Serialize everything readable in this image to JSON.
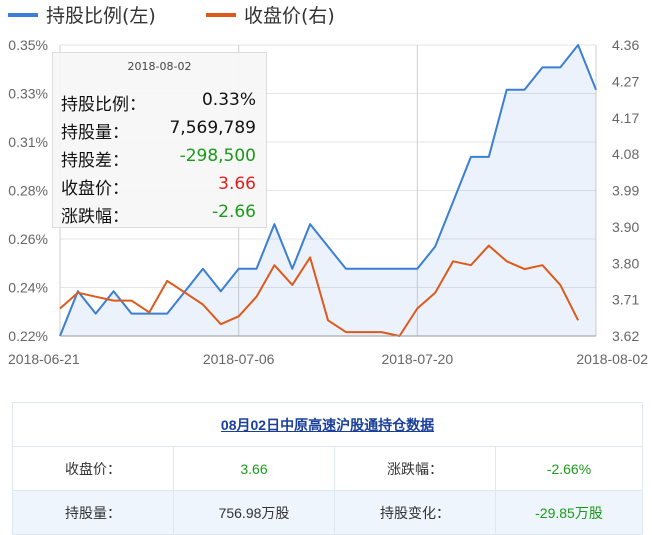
{
  "chart_data": {
    "type": "line",
    "legend": [
      {
        "name": "持股比例(左)",
        "color": "#3a7fd5"
      },
      {
        "name": "收盘价(右)",
        "color": "#dd5a1c"
      }
    ],
    "legend_position": "top-left",
    "x_tick_labels": [
      "2018-06-21",
      "2018-07-06",
      "2018-07-20",
      "2018-08-02"
    ],
    "y_left_ticks": [
      "0.35%",
      "0.33%",
      "0.31%",
      "0.28%",
      "0.26%",
      "0.24%",
      "0.22%"
    ],
    "y_right_ticks": [
      "4.36",
      "4.27",
      "4.17",
      "4.08",
      "3.99",
      "3.90",
      "3.80",
      "3.71",
      "3.62"
    ],
    "ylim_left": [
      0.22,
      0.35
    ],
    "ylim_right": [
      3.62,
      4.36
    ],
    "series": [
      {
        "name": "持股比例(左)",
        "axis": "left",
        "color": "#3a7fd5",
        "values": [
          0.22,
          0.24,
          0.23,
          0.24,
          0.23,
          0.23,
          0.23,
          0.24,
          0.25,
          0.24,
          0.25,
          0.25,
          0.27,
          0.25,
          0.27,
          0.26,
          0.25,
          0.25,
          0.25,
          0.25,
          0.25,
          0.26,
          0.28,
          0.3,
          0.3,
          0.33,
          0.33,
          0.34,
          0.34,
          0.35,
          0.33
        ]
      },
      {
        "name": "收盘价(右)",
        "axis": "right",
        "color": "#dd5a1c",
        "values": [
          3.69,
          3.73,
          3.72,
          3.71,
          3.71,
          3.68,
          3.76,
          3.73,
          3.7,
          3.65,
          3.67,
          3.72,
          3.8,
          3.75,
          3.82,
          3.66,
          3.63,
          3.63,
          3.63,
          3.62,
          3.69,
          3.73,
          3.81,
          3.8,
          3.85,
          3.81,
          3.79,
          3.8,
          3.75,
          3.66
        ]
      }
    ],
    "grid": true,
    "highlight_x_index": 30
  },
  "tooltip": {
    "date": "2018-08-02",
    "rows": [
      {
        "label": "持股比例：",
        "value": "0.33%",
        "tone": "normal"
      },
      {
        "label": "持股量：",
        "value": "7,569,789",
        "tone": "normal"
      },
      {
        "label": "持股差：",
        "value": "-298,500",
        "tone": "green"
      },
      {
        "label": "收盘价：",
        "value": "3.66",
        "tone": "red"
      },
      {
        "label": "涨跌幅：",
        "value": "-2.66",
        "tone": "green"
      }
    ]
  },
  "table": {
    "title": "08月02日中原高速沪股通持仓数据",
    "rows": [
      [
        {
          "text": "收盘价：",
          "tone": "normal"
        },
        {
          "text": "3.66",
          "tone": "green"
        },
        {
          "text": "涨跌幅：",
          "tone": "normal"
        },
        {
          "text": "-2.66%",
          "tone": "green"
        }
      ],
      [
        {
          "text": "持股量：",
          "tone": "normal"
        },
        {
          "text": "756.98万股",
          "tone": "normal"
        },
        {
          "text": "持股变化：",
          "tone": "normal"
        },
        {
          "text": "-29.85万股",
          "tone": "green"
        }
      ]
    ]
  }
}
